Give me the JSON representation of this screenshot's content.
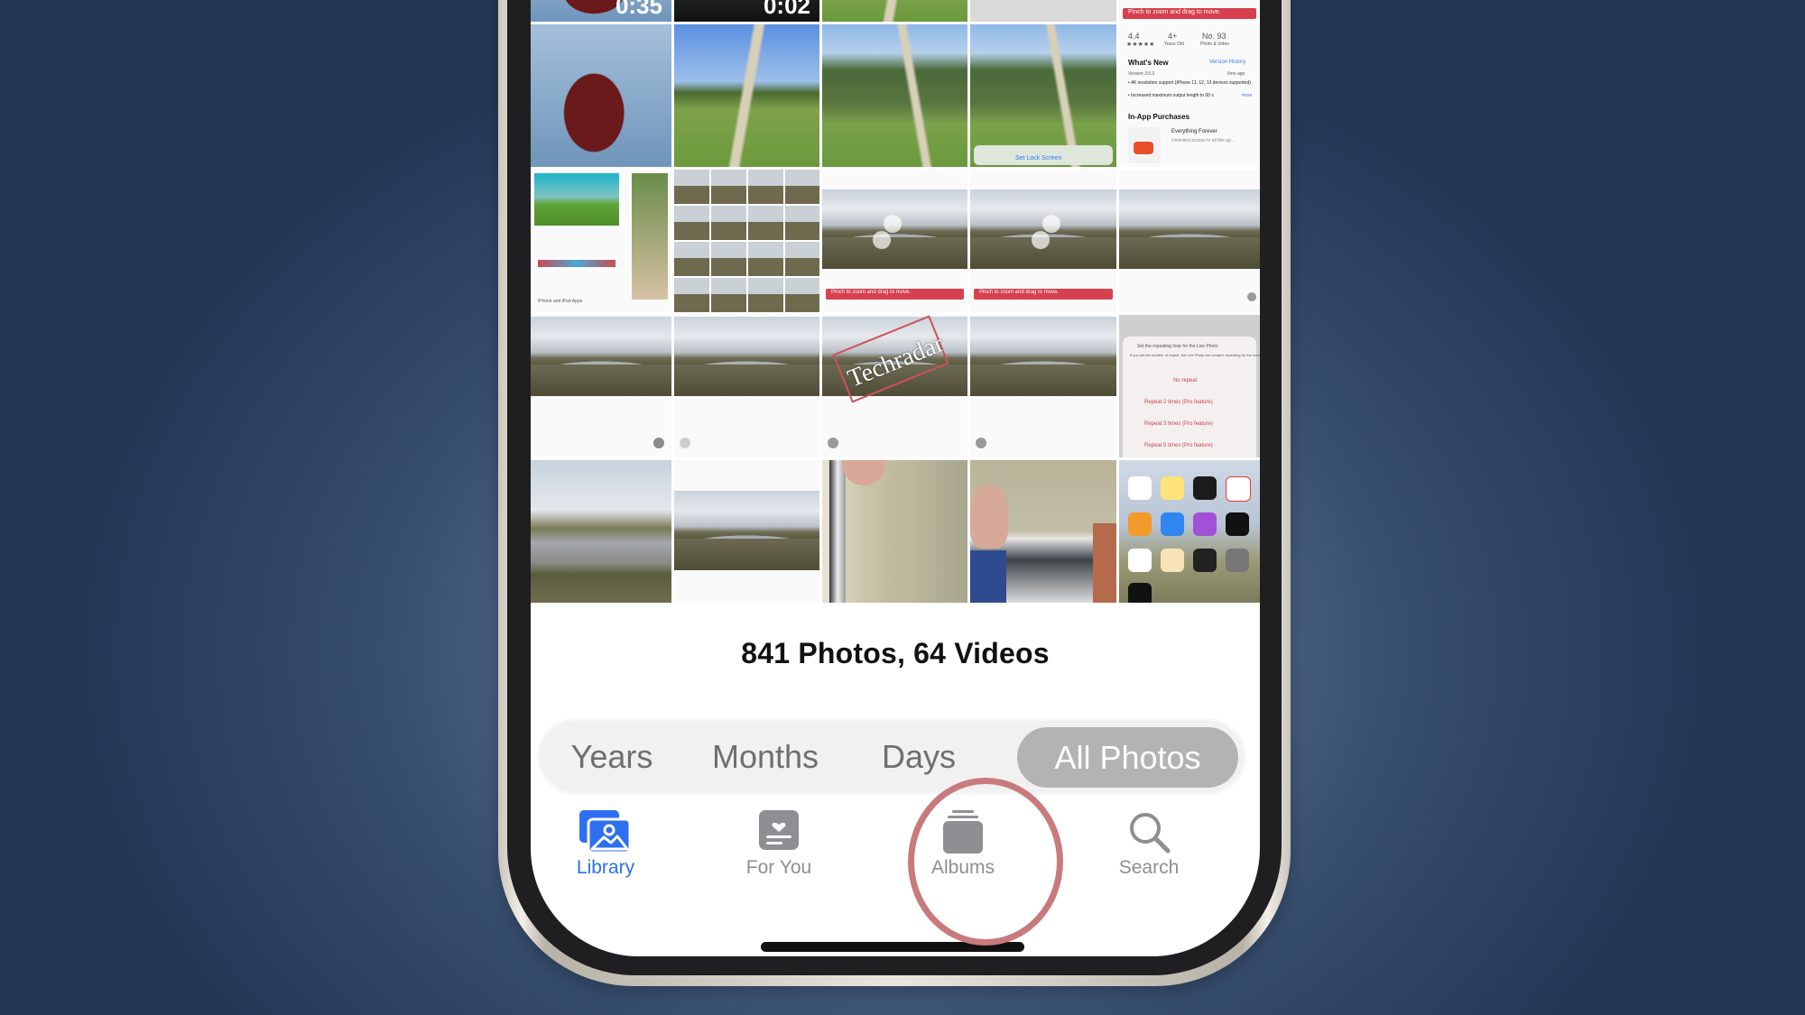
{
  "background": {
    "gradient_center": "#7088a4",
    "gradient_edge": "#243856"
  },
  "grid": {
    "row0": [
      {
        "type": "video",
        "scene": "man-in-chair",
        "duration": "0:35"
      },
      {
        "type": "video",
        "scene": "dark-clip",
        "duration": "0:02"
      },
      {
        "type": "photo",
        "scene": "field-path"
      },
      {
        "type": "photo",
        "scene": "screenshot-grey"
      },
      {
        "type": "screenshot",
        "scene": "app-store-banner",
        "banner_text": "Pinch to zoom and drag to move."
      }
    ],
    "row1": [
      {
        "type": "photo",
        "scene": "man-in-red-chair"
      },
      {
        "type": "photo",
        "scene": "country-path-blue-sky"
      },
      {
        "type": "photo",
        "scene": "trees-and-path"
      },
      {
        "type": "photo",
        "scene": "trees-and-path-lockscreen",
        "button_text": "Set Lock Screen"
      },
      {
        "type": "screenshot",
        "scene": "app-store-listing",
        "ratings": {
          "label": "4.4",
          "stars": "★★★★★",
          "age": "4+",
          "age_label": "Years Old",
          "rank": "No. 93",
          "rank_label": "Photo & Video"
        },
        "whats_new_title": "What's New",
        "version_history_link": "Version History",
        "version": "Version 3.5.3",
        "time_ago": "6mo ago",
        "notes": [
          "• 4K resolution support (iPhone 11, 12, 13 devices supported)",
          "• Increased maximum output length to 60 s"
        ],
        "more_link": "more",
        "iap_title": "In-App Purchases",
        "iap_item": "Everything Forever",
        "iap_desc": "Unlimited access to all this ap..."
      }
    ],
    "row2": [
      {
        "type": "screenshot",
        "scene": "editor-app",
        "caption": "iPhone and iPad Apps"
      },
      {
        "type": "screenshot",
        "scene": "frames-grid"
      },
      {
        "type": "screenshot",
        "scene": "lake-zoom-1",
        "banner_text": "Pinch to zoom and drag to move."
      },
      {
        "type": "screenshot",
        "scene": "lake-zoom-2",
        "banner_text": "Pinch to zoom and drag to move."
      },
      {
        "type": "screenshot",
        "scene": "lake-zoom-3"
      }
    ],
    "row3": [
      {
        "type": "screenshot",
        "scene": "lake-a"
      },
      {
        "type": "screenshot",
        "scene": "lake-b"
      },
      {
        "type": "screenshot",
        "scene": "lake-watermark",
        "watermark_text": "Techradar"
      },
      {
        "type": "screenshot",
        "scene": "lake-c"
      },
      {
        "type": "screenshot",
        "scene": "repeat-menu",
        "menu_title": "Set the repeating loop for the Live Photo",
        "menu_desc": "If you set the number of repeat, the Live Photo are created, repeating for the number set.",
        "options": [
          "No repeat",
          "Repeat 2 times (Pro feature)",
          "Repeat 3 times (Pro feature)",
          "Repeat 5 times (Pro feature)"
        ]
      }
    ],
    "row4": [
      {
        "type": "photo",
        "scene": "lake-wide"
      },
      {
        "type": "photo",
        "scene": "lake-landscape"
      },
      {
        "type": "photo",
        "scene": "selfie-upside-down"
      },
      {
        "type": "photo",
        "scene": "selfie-window"
      },
      {
        "type": "screenshot",
        "scene": "home-screen"
      }
    ]
  },
  "library": {
    "count_label": "841 Photos, 64 Videos"
  },
  "segmented_control": {
    "items": [
      {
        "label": "Years",
        "selected": false
      },
      {
        "label": "Months",
        "selected": false
      },
      {
        "label": "Days",
        "selected": false
      },
      {
        "label": "All Photos",
        "selected": true
      }
    ]
  },
  "tabbar": {
    "active_color": "#2e6ff0",
    "inactive_color": "#8e8e93",
    "items": [
      {
        "label": "Library",
        "icon": "photo-stack-icon",
        "active": true
      },
      {
        "label": "For You",
        "icon": "for-you-card-icon",
        "active": false
      },
      {
        "label": "Albums",
        "icon": "albums-stack-icon",
        "active": false,
        "highlighted": true
      },
      {
        "label": "Search",
        "icon": "magnifier-icon",
        "active": false
      }
    ]
  },
  "annotation": {
    "highlight_color": "#c97a7c",
    "target": "Albums"
  }
}
